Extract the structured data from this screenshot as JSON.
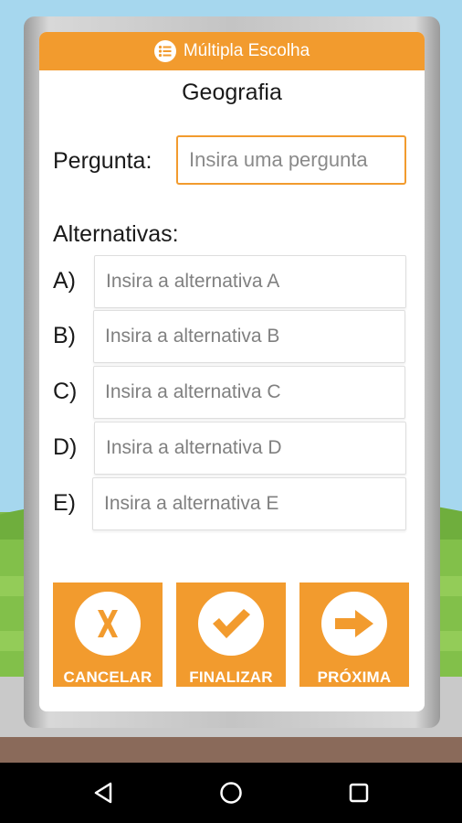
{
  "header": {
    "title": "Múltipla Escolha",
    "icon": "list-icon"
  },
  "subject": "Geografia",
  "question": {
    "label": "Pergunta:",
    "placeholder": "Insira uma pergunta"
  },
  "alternatives": {
    "label": "Alternativas:",
    "items": [
      {
        "letter": "A)",
        "placeholder": "Insira a alternativa A"
      },
      {
        "letter": "B)",
        "placeholder": "Insira a alternativa B"
      },
      {
        "letter": "C)",
        "placeholder": "Insira a alternativa C"
      },
      {
        "letter": "D)",
        "placeholder": "Insira a alternativa D"
      },
      {
        "letter": "E)",
        "placeholder": "Insira a alternativa E"
      }
    ]
  },
  "actions": {
    "cancel": {
      "label": "CANCELAR",
      "icon": "x-icon"
    },
    "finish": {
      "label": "FINALIZAR",
      "icon": "checkmark-icon"
    },
    "next": {
      "label": "PRÓXIMA",
      "icon": "arrow-right-icon"
    }
  },
  "colors": {
    "accent": "#f29b2e"
  },
  "navbar": {
    "back": "back-triangle-icon",
    "home": "home-circle-icon",
    "recents": "recents-square-icon"
  }
}
